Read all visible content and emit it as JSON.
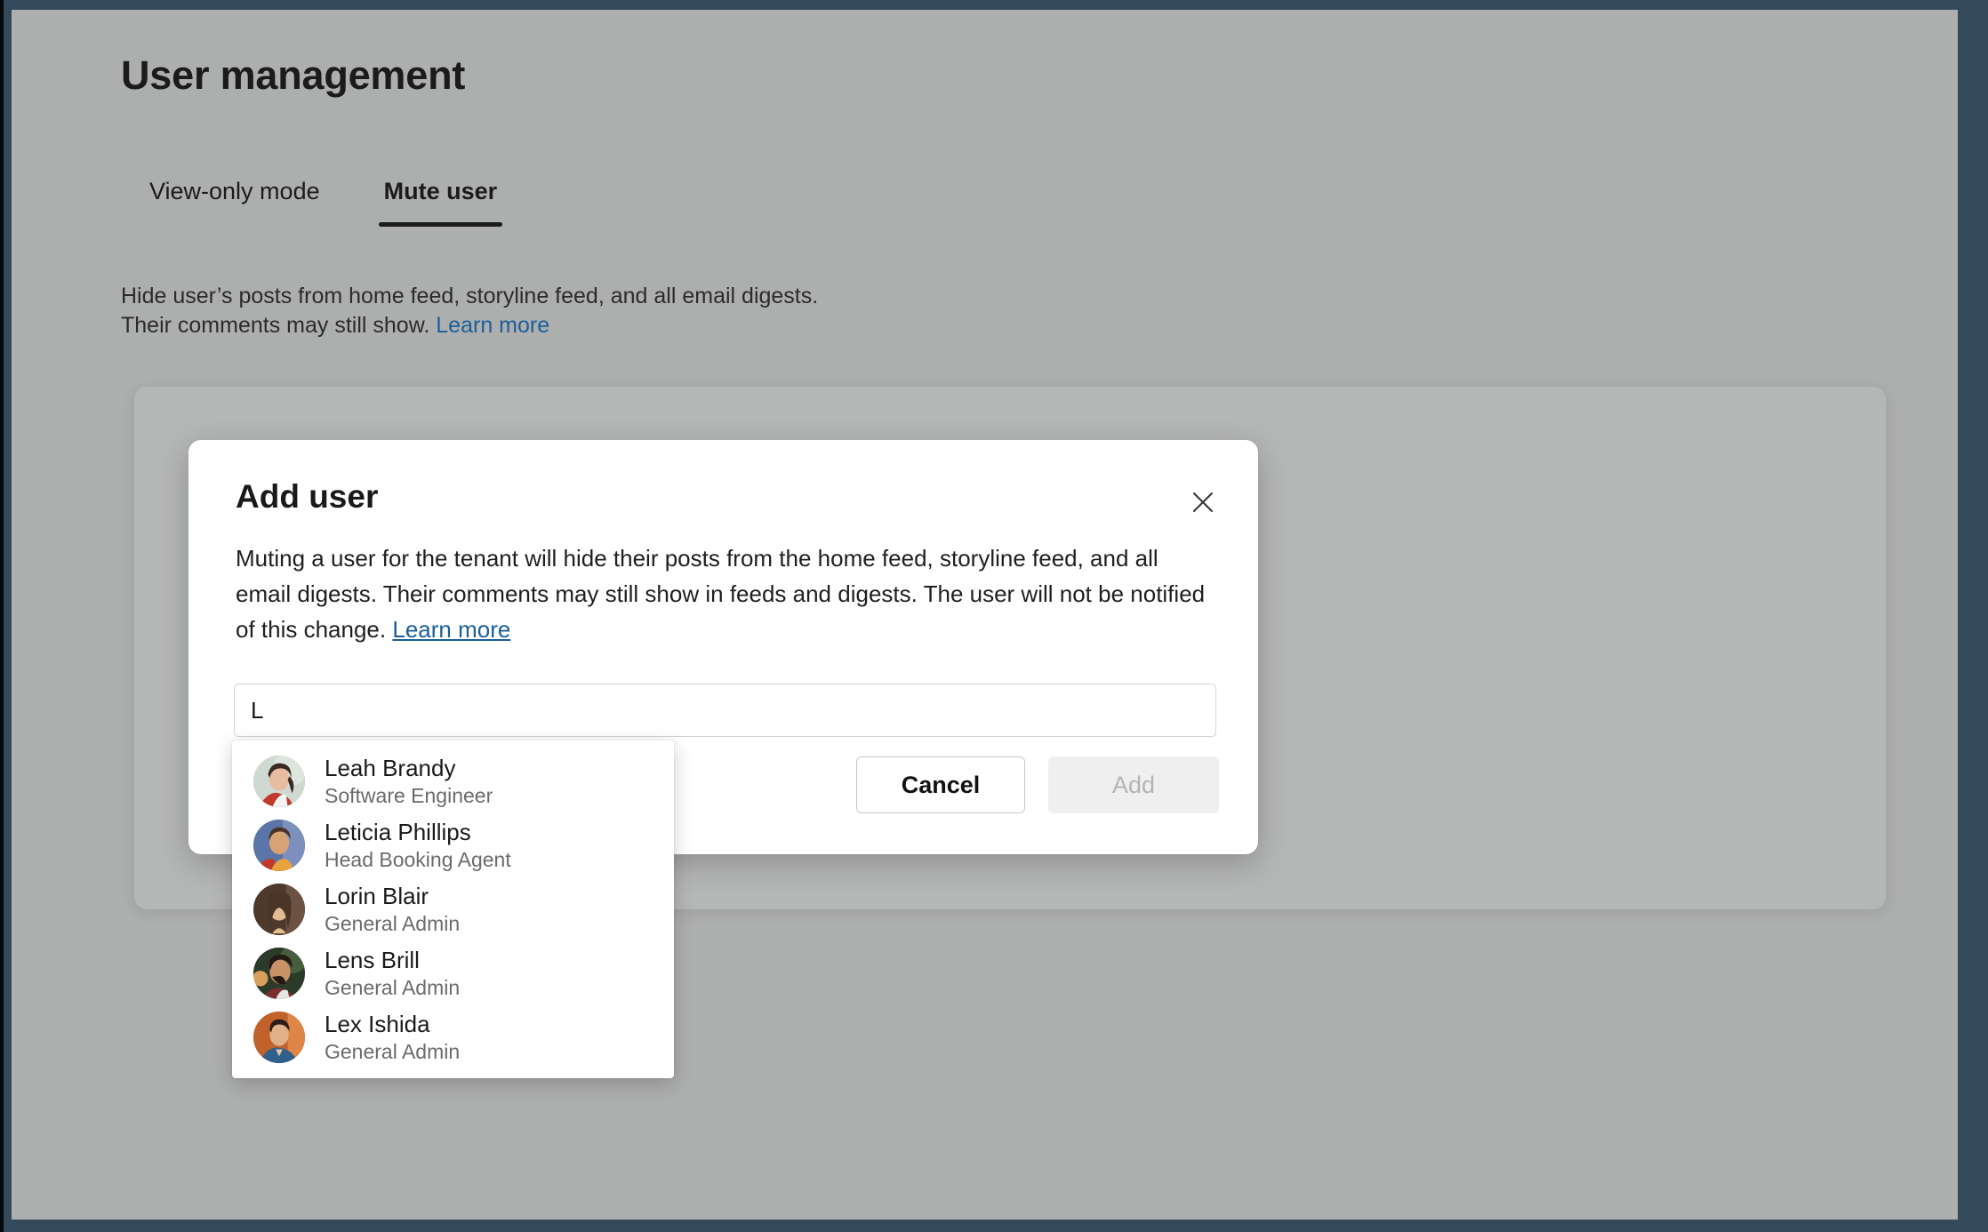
{
  "page": {
    "title": "User management",
    "tabs": [
      {
        "label": "View-only mode",
        "active": false
      },
      {
        "label": "Mute user",
        "active": true
      }
    ],
    "description_line1": "Hide user’s posts from home feed, storyline feed, and all email digests.",
    "description_line2": "Their comments may still show.",
    "description_link": "Learn more"
  },
  "dialog": {
    "title": "Add user",
    "close_icon": "close-icon",
    "body_text": "Muting a user for the tenant will hide their posts from the home feed, storyline feed, and all email digests. Their comments may still show in feeds and digests. The user will not be notified of this change.",
    "body_link": "Learn more",
    "search": {
      "value": "L",
      "placeholder": ""
    },
    "buttons": {
      "cancel": "Cancel",
      "add": "Add",
      "add_disabled": true
    }
  },
  "suggestions": [
    {
      "name": "Leah Brandy",
      "role": "Software Engineer",
      "avatar": "avatar-leah-brandy",
      "colors": [
        "#c9d6cf",
        "#e1e6e0",
        "#c0392b",
        "#3b2a24"
      ]
    },
    {
      "name": "Leticia Phillips",
      "role": "Head Booking Agent",
      "avatar": "avatar-leticia-phillips",
      "colors": [
        "#5b75a8",
        "#7d90bd",
        "#e8a33d",
        "#4a3328"
      ]
    },
    {
      "name": "Lorin Blair",
      "role": "General Admin",
      "avatar": "avatar-lorin-blair",
      "colors": [
        "#4e3a2c",
        "#6b5242",
        "#e3bb91",
        "#2e2019"
      ]
    },
    {
      "name": "Lens Brill",
      "role": "General Admin",
      "avatar": "avatar-lens-brill",
      "colors": [
        "#2c3a2a",
        "#485c3f",
        "#d9a05b",
        "#241a14"
      ]
    },
    {
      "name": "Lex Ishida",
      "role": "General Admin",
      "avatar": "avatar-lex-ishida",
      "colors": [
        "#c1622b",
        "#dd8648",
        "#2f5f8a",
        "#2a1d15"
      ]
    }
  ],
  "colors": {
    "window_border": "#34495a",
    "page_background": "#adaeae",
    "card_background": "#b5b6b6",
    "dialog_background": "#ffffff",
    "link": "#1a5e9a",
    "text_primary": "#1b1b1b",
    "text_secondary": "#6b6b6b",
    "tab_indicator": "#1b1b1b",
    "disabled_button": "#efefef",
    "disabled_button_text": "#b4b4b4"
  }
}
